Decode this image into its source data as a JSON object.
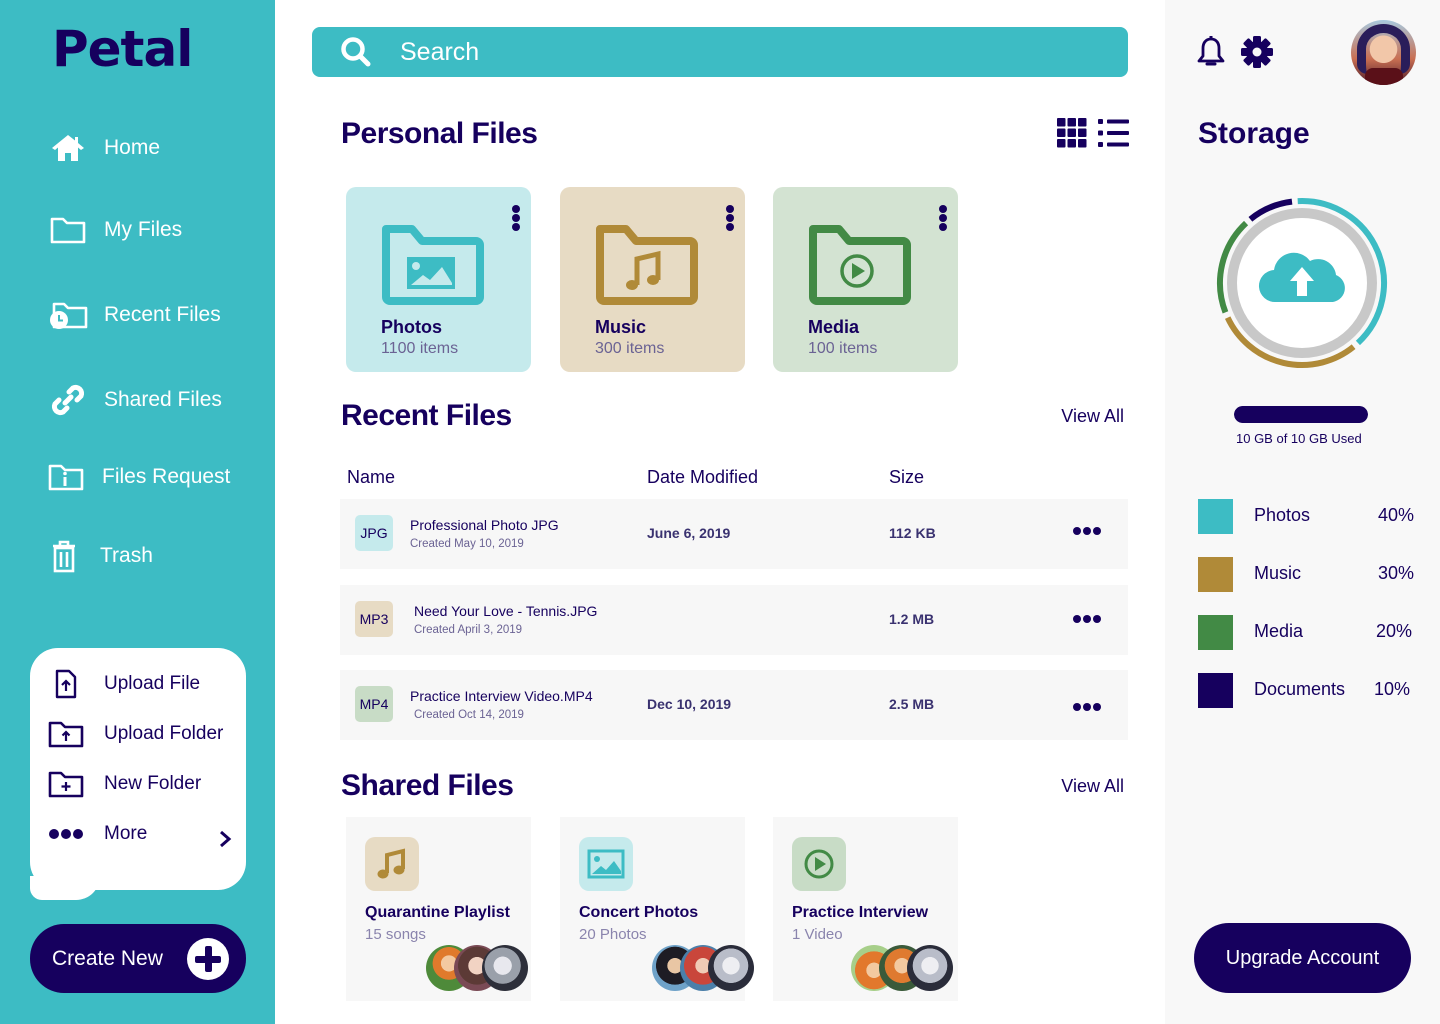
{
  "brand": {
    "name": "Petal"
  },
  "colors": {
    "primary": "#3dbcc4",
    "navy": "#16005e",
    "photos": "#3dbcc4",
    "music": "#b08a38",
    "media": "#428a45",
    "documents": "#16005e"
  },
  "sidebar": {
    "items": [
      {
        "label": "Home",
        "icon": "home-icon"
      },
      {
        "label": "My Files",
        "icon": "folder-icon"
      },
      {
        "label": "Recent Files",
        "icon": "recent-folder-icon"
      },
      {
        "label": "Shared Files",
        "icon": "link-icon"
      },
      {
        "label": "Files Request",
        "icon": "folder-info-icon"
      },
      {
        "label": "Trash",
        "icon": "trash-icon"
      }
    ],
    "actions": [
      {
        "label": "Upload File",
        "icon": "upload-file-icon"
      },
      {
        "label": "Upload Folder",
        "icon": "upload-folder-icon"
      },
      {
        "label": "New Folder",
        "icon": "new-folder-icon"
      },
      {
        "label": "More",
        "icon": "more-dots-icon"
      }
    ],
    "create_label": "Create New"
  },
  "search": {
    "placeholder": "Search"
  },
  "personal": {
    "title": "Personal Files",
    "folders": [
      {
        "name": "Photos",
        "count": "1100 items",
        "icon": "photo-folder-icon"
      },
      {
        "name": "Music",
        "count": "300 items",
        "icon": "music-folder-icon"
      },
      {
        "name": "Media",
        "count": "100 items",
        "icon": "video-folder-icon"
      }
    ]
  },
  "recent": {
    "title": "Recent Files",
    "view_all": "View All",
    "columns": [
      "Name",
      "Date Modified",
      "Size"
    ],
    "rows": [
      {
        "type": "JPG",
        "name": "Professional Photo JPG",
        "created": "Created May 10, 2019",
        "modified": "June 6, 2019",
        "size": "112 KB"
      },
      {
        "type": "MP3",
        "name": "Need Your Love - Tennis.JPG",
        "created": "Created April 3, 2019",
        "modified": "",
        "size": "1.2 MB"
      },
      {
        "type": "MP4",
        "name": "Practice Interview Video.MP4",
        "created": "Created Oct 14, 2019",
        "modified": "Dec 10, 2019",
        "size": "2.5 MB"
      }
    ]
  },
  "shared": {
    "title": "Shared Files",
    "view_all": "View All",
    "items": [
      {
        "name": "Quarantine Playlist",
        "meta": "15 songs",
        "icon": "music-note-icon"
      },
      {
        "name": "Concert Photos",
        "meta": "20 Photos",
        "icon": "image-icon"
      },
      {
        "name": "Practice Interview",
        "meta": "1 Video",
        "icon": "play-circle-icon"
      }
    ]
  },
  "storage": {
    "title": "Storage",
    "used_text": "10 GB of 10 GB Used",
    "used_fraction": 1.0,
    "breakdown": [
      {
        "label": "Photos",
        "percent": "40%",
        "value": 40
      },
      {
        "label": "Music",
        "percent": "30%",
        "value": 30
      },
      {
        "label": "Media",
        "percent": "20%",
        "value": 20
      },
      {
        "label": "Documents",
        "percent": "10%",
        "value": 10
      }
    ]
  },
  "upgrade_label": "Upgrade Account"
}
